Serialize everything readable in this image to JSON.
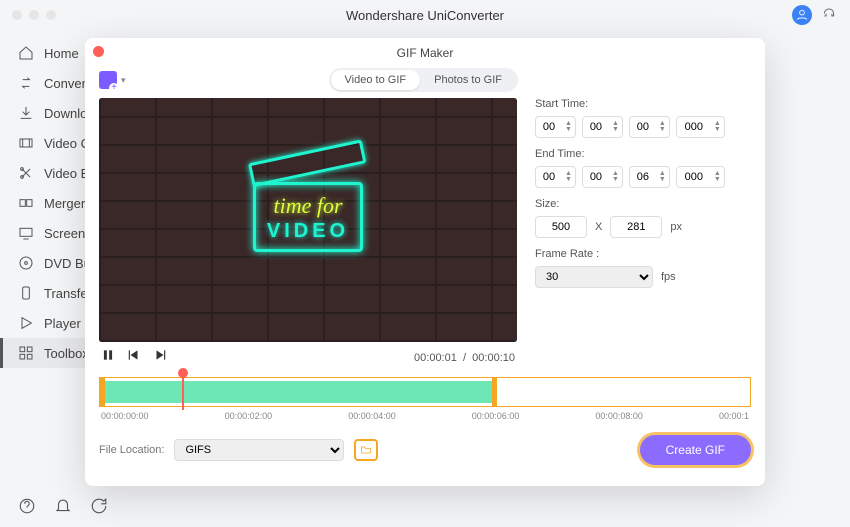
{
  "app_title": "Wondershare UniConverter",
  "sidebar": {
    "items": [
      {
        "label": "Home",
        "icon": "home-icon"
      },
      {
        "label": "Convert",
        "icon": "convert-icon"
      },
      {
        "label": "Downloa",
        "icon": "download-icon"
      },
      {
        "label": "Video C",
        "icon": "video-compress-icon"
      },
      {
        "label": "Video E",
        "icon": "video-edit-icon"
      },
      {
        "label": "Merger",
        "icon": "merger-icon"
      },
      {
        "label": "Screen ",
        "icon": "screen-rec-icon"
      },
      {
        "label": "DVD Bu",
        "icon": "dvd-icon"
      },
      {
        "label": "Transfer",
        "icon": "transfer-icon"
      },
      {
        "label": "Player",
        "icon": "player-icon"
      },
      {
        "label": "Toolbox",
        "icon": "toolbox-icon"
      }
    ],
    "active_index": 10
  },
  "modal": {
    "title": "GIF Maker",
    "tabs": {
      "video": "Video to GIF",
      "photos": "Photos to GIF",
      "active": "video"
    },
    "preview": {
      "neon_line1": "time for",
      "neon_line2": "VIDEO"
    },
    "playback": {
      "current": "00:00:01",
      "sep": "/",
      "total": "00:00:10"
    },
    "params": {
      "start_label": "Start Time:",
      "start": [
        "00",
        "00",
        "00",
        "000"
      ],
      "end_label": "End Time:",
      "end": [
        "00",
        "00",
        "06",
        "000"
      ],
      "size_label": "Size:",
      "size_w": "500",
      "size_x": "X",
      "size_h": "281",
      "size_unit": "px",
      "fr_label": "Frame Rate :",
      "fr_value": "30",
      "fr_unit": "fps"
    },
    "ruler": [
      "00:00:00:00",
      "00:00:02:00",
      "00:00:04:00",
      "00:00:06:00",
      "00:00:08:00",
      "00:00:1"
    ],
    "footer": {
      "loc_label": "File Location:",
      "loc_value": "GIFS",
      "create": "Create GIF"
    }
  }
}
